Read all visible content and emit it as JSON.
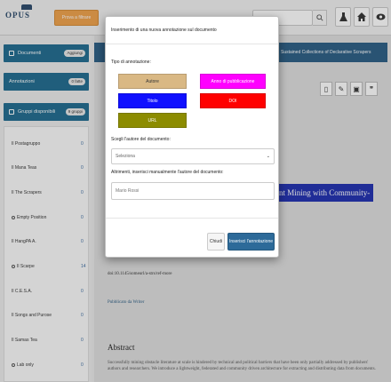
{
  "topbar": {
    "logo_text": "OPUS",
    "brand_button": "Prova a filtrare",
    "search_placeholder": "",
    "icons": [
      "search-icon",
      "flask-icon",
      "home-icon",
      "eye-icon"
    ]
  },
  "sidebar": {
    "documenti": {
      "label": "Documenti",
      "count": "0",
      "badge": "Aggiungi"
    },
    "annotazioni": {
      "label": "Annotazioni",
      "badge": "0 fatte"
    },
    "gruppi": {
      "label": "Gruppi disponibili",
      "badge": "9 gruppi"
    },
    "groups": [
      {
        "label": "Il Postagruppo",
        "n": "0"
      },
      {
        "label": "Il Mana Teas",
        "n": "0"
      },
      {
        "label": "Il The Scrapers",
        "n": "0"
      },
      {
        "label": "Empty Position",
        "n": "0"
      },
      {
        "label": "Il HangPA A.",
        "n": "0"
      },
      {
        "label": "Il Scarpe",
        "n": "14"
      },
      {
        "label": "Il C.E.S.A.",
        "n": "0"
      },
      {
        "label": "Il Songs and Purose",
        "n": "0"
      },
      {
        "label": "Il Samas Tea",
        "n": "0"
      },
      {
        "label": "Lab only",
        "n": "0"
      }
    ]
  },
  "document": {
    "title_bar": "Sustained Collections of Declarative Scrapers",
    "highlighted_title": "ent Mining with Community-",
    "doi": "doi:10.1145/someurl/a-strs/ref-more",
    "published_by": "Pubblicato da Writer",
    "abstract_heading": "Abstract",
    "abstract_text": "Successfully mining obstacle literature at scale is hindered by technical and political barriers that have been only partially addressed by publishers' authors and researchers. We introduce a lightweight, federated and community driven architecture for extracting and distributing data from documents."
  },
  "modal": {
    "title": "Inserimento di una nuova annotazione sul documento",
    "type_label": "Tipo di annotazione:",
    "tags": [
      {
        "label": "Autore",
        "color": "#d9b884",
        "text_color": "#333333"
      },
      {
        "label": "Anno di pubblicazione",
        "color": "#ff00ff",
        "text_color": "#ffffff"
      },
      {
        "label": "Titolo",
        "color": "#1010ff",
        "text_color": "#ffffff"
      },
      {
        "label": "DOI",
        "color": "#ff0000",
        "text_color": "#ffffff"
      },
      {
        "label": "URL",
        "color": "#8c8c00",
        "text_color": "#ffffff"
      }
    ],
    "author_label": "Scegli l'autore del documento:",
    "select_value": "Seleziona",
    "manual_label": "Altrimenti, inserisci manualmente l'autore del documento:",
    "input_placeholder": "Mario Rossi",
    "cancel_label": "Chiudi",
    "submit_label": "Inserisci l'annotazione"
  }
}
